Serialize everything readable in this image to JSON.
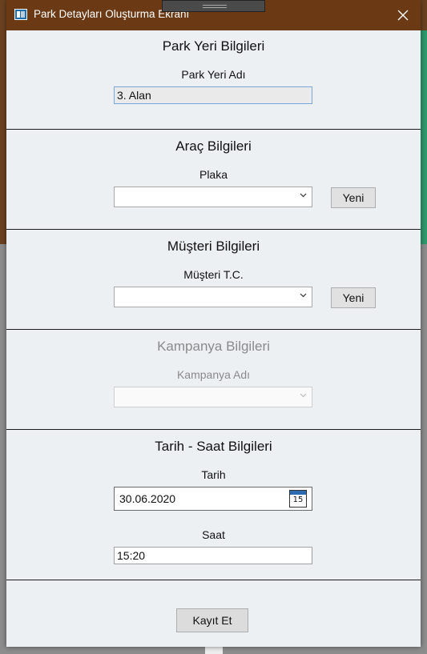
{
  "window": {
    "title": "Park Detayları Oluşturma Ekranı"
  },
  "park": {
    "section_title": "Park Yeri Bilgileri",
    "name_label": "Park Yeri Adı",
    "name_value": "3. Alan"
  },
  "vehicle": {
    "section_title": "Araç Bilgileri",
    "plate_label": "Plaka",
    "plate_value": "",
    "new_button": "Yeni"
  },
  "customer": {
    "section_title": "Müşteri Bilgileri",
    "id_label": "Müşteri T.C.",
    "id_value": "",
    "new_button": "Yeni"
  },
  "campaign": {
    "section_title": "Kampanya Bilgileri",
    "name_label": "Kampanya Adı",
    "name_value": "",
    "enabled": false
  },
  "datetime": {
    "section_title": "Tarih - Saat Bilgileri",
    "date_label": "Tarih",
    "date_value": "30.06.2020",
    "calendar_day": "15",
    "time_label": "Saat",
    "time_value": "15:20"
  },
  "actions": {
    "save_button": "Kayıt Et"
  },
  "icons": {
    "app": "window-app-icon",
    "close": "close-icon",
    "dropdown": "chevron-down-icon",
    "calendar": "calendar-icon"
  },
  "colors": {
    "title_bar": "#6b3a14",
    "window_bg": "#ecf0f2",
    "disabled_text": "#8a8a8a"
  }
}
